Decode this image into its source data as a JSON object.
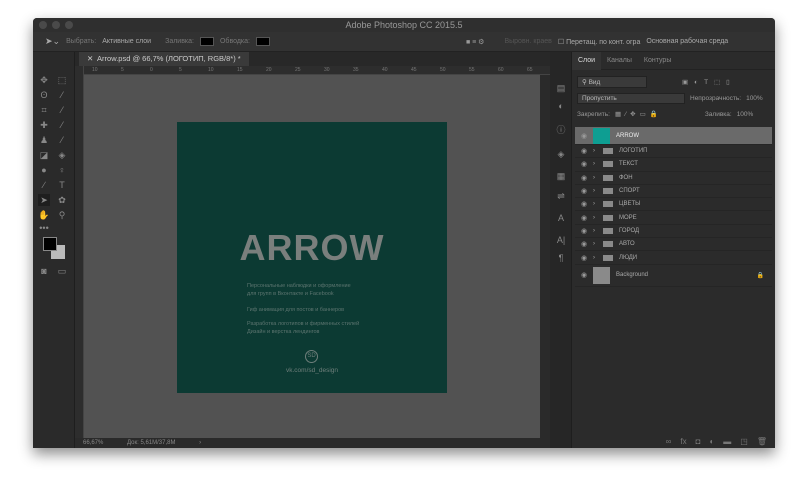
{
  "window": {
    "title": "Adobe Photoshop CC 2015.5"
  },
  "options": {
    "select_label": "Выбрать:",
    "select_value": "Активные слои",
    "fill_label": "Заливка:",
    "stroke_label": "Обводка:",
    "align_label": "Выровн. краев",
    "drag_label": "Перетащ. по конт. огра",
    "workspace": "Основная рабочая среда"
  },
  "document": {
    "tab": "Arrow.psd @ 66,7% (ЛОГОТИП, RGB/8*) *",
    "zoom": "66,67%",
    "doc_size": "Док: 5,61M/37,8M"
  },
  "ruler": [
    "10",
    "5",
    "0",
    "5",
    "10",
    "15",
    "20",
    "25",
    "30",
    "35",
    "40",
    "45",
    "50",
    "55",
    "60",
    "65"
  ],
  "artboard": {
    "title": "ARROW",
    "lines": [
      "Персональные наблюдки и оформление",
      "для групп в Вконтакте и Facebook",
      "Гиф анимация для постов и баннеров",
      "Разработка логотипов и фирменных стилей",
      "Дизайн и верстка лендингов"
    ],
    "logo_text": "SD",
    "link": "vk.com/sd_design",
    "bg_color": "#0c3a33"
  },
  "panel": {
    "tabs": [
      "Слои",
      "Каналы",
      "Контуры"
    ],
    "filter": "Вид",
    "blend": "Пропустить",
    "opacity_label": "Непрозрачность:",
    "opacity": "100%",
    "lock_label": "Закрепить:",
    "fill_label": "Заливка:",
    "fill": "100%"
  },
  "layers": {
    "selected": "ARROW",
    "groups": [
      "ЛОГОТИП",
      "ТЕКСТ",
      "ФОН",
      "СПОРТ",
      "ЦВЕТЫ",
      "МОРЕ",
      "ГОРОД",
      "АВТО",
      "ЛЮДИ"
    ],
    "background": "Background"
  }
}
